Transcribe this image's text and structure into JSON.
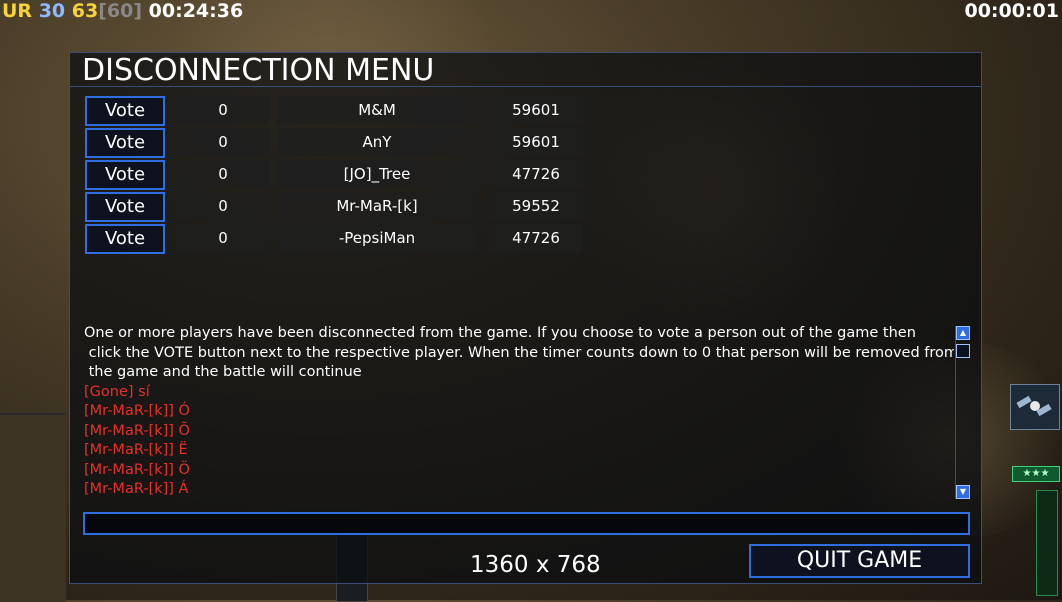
{
  "hud": {
    "ur": "UR",
    "stat_a": "30",
    "stat_b": "63",
    "stat_c": "[60]",
    "elapsed": "00:24:36",
    "countdown": "00:00:01"
  },
  "dialog": {
    "title": "DISCONNECTION MENU",
    "vote_label": "Vote",
    "players": [
      {
        "count": "0",
        "name": "M&M",
        "id": "59601"
      },
      {
        "count": "0",
        "name": "AnY",
        "id": "59601"
      },
      {
        "count": "0",
        "name": "[JO]_Tree",
        "id": "47726"
      },
      {
        "count": "0",
        "name": "Mr-MaR-[k]",
        "id": "59552"
      },
      {
        "count": "0",
        "name": "-PepsiMan",
        "id": "47726"
      }
    ],
    "chat": {
      "info": [
        "One or more players have been disconnected from the game. If you choose to vote a person out of the game then",
        " click the VOTE button next to the respective player. When the timer counts down to 0 that person will be removed from",
        " the game and the battle will continue"
      ],
      "messages": [
        "[Gone] sí",
        "[Mr-MaR-[k]] Ó",
        "[Mr-MaR-[k]] Õ",
        "[Mr-MaR-[k]] Ë",
        "[Mr-MaR-[k]] Ö",
        "[Mr-MaR-[k]] Á"
      ]
    },
    "chat_input_value": "",
    "resolution": "1360 x 768",
    "quit_label": "QUIT GAME"
  },
  "colors": {
    "accent": "#2f6ee0",
    "chat_red": "#e8302a",
    "hud_yellow": "#f7d23a"
  },
  "icons": {
    "scroll_up": "triangle-up-icon",
    "scroll_down": "triangle-down-icon",
    "satellite": "satellite-icon"
  }
}
